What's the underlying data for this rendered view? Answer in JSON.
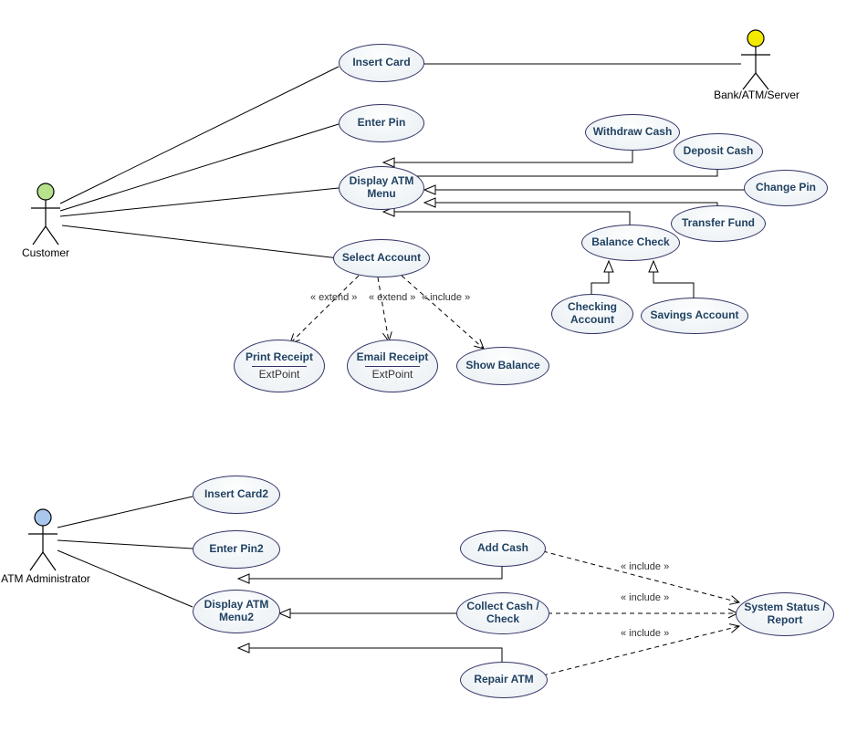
{
  "actors": {
    "customer": {
      "label": "Customer"
    },
    "bankServer": {
      "label": "Bank/ATM/Server"
    },
    "atmAdmin": {
      "label": "ATM Administrator"
    }
  },
  "usecases": {
    "insertCard": {
      "label": "Insert Card"
    },
    "enterPin": {
      "label": "Enter Pin"
    },
    "displayMenu": {
      "label": "Display ATM Menu"
    },
    "selectAccount": {
      "label": "Select Account"
    },
    "withdrawCash": {
      "label": "Withdraw Cash"
    },
    "depositCash": {
      "label": "Deposit Cash"
    },
    "changePin": {
      "label": "Change Pin"
    },
    "transferFund": {
      "label": "Transfer Fund"
    },
    "balanceCheck": {
      "label": "Balance Check"
    },
    "checkingAcct": {
      "label": "Checking Account"
    },
    "savingsAcct": {
      "label": "Savings Account"
    },
    "printReceipt": {
      "label": "Print Receipt",
      "extPoint": "ExtPoint"
    },
    "emailReceipt": {
      "label": "Email Receipt",
      "extPoint": "ExtPoint"
    },
    "showBalance": {
      "label": "Show Balance"
    },
    "insertCard2": {
      "label": "Insert Card2"
    },
    "enterPin2": {
      "label": "Enter Pin2"
    },
    "displayMenu2": {
      "label": "Display ATM Menu2"
    },
    "addCash": {
      "label": "Add Cash"
    },
    "collectCash": {
      "label": "Collect Cash / Check"
    },
    "repairATM": {
      "label": "Repair ATM"
    },
    "systemStatus": {
      "label": "System Status / Report"
    }
  },
  "relationLabels": {
    "extend1": "« extend »",
    "extend2": "« extend »",
    "include1": "« include »",
    "include2": "« include »",
    "include3": "« include »",
    "include4": "« include »"
  },
  "chart_data": {
    "type": "uml-usecase-diagram",
    "actors": [
      {
        "id": "customer",
        "name": "Customer"
      },
      {
        "id": "bankServer",
        "name": "Bank/ATM/Server"
      },
      {
        "id": "atmAdmin",
        "name": "ATM Administrator"
      }
    ],
    "usecases": [
      {
        "id": "insertCard",
        "name": "Insert Card"
      },
      {
        "id": "enterPin",
        "name": "Enter Pin"
      },
      {
        "id": "displayMenu",
        "name": "Display ATM Menu"
      },
      {
        "id": "selectAccount",
        "name": "Select Account"
      },
      {
        "id": "withdrawCash",
        "name": "Withdraw Cash"
      },
      {
        "id": "depositCash",
        "name": "Deposit Cash"
      },
      {
        "id": "changePin",
        "name": "Change Pin"
      },
      {
        "id": "transferFund",
        "name": "Transfer Fund"
      },
      {
        "id": "balanceCheck",
        "name": "Balance Check"
      },
      {
        "id": "checkingAcct",
        "name": "Checking Account"
      },
      {
        "id": "savingsAcct",
        "name": "Savings Account"
      },
      {
        "id": "printReceipt",
        "name": "Print Receipt",
        "extensionPoint": "ExtPoint"
      },
      {
        "id": "emailReceipt",
        "name": "Email Receipt",
        "extensionPoint": "ExtPoint"
      },
      {
        "id": "showBalance",
        "name": "Show Balance"
      },
      {
        "id": "insertCard2",
        "name": "Insert Card2"
      },
      {
        "id": "enterPin2",
        "name": "Enter Pin2"
      },
      {
        "id": "displayMenu2",
        "name": "Display ATM Menu2"
      },
      {
        "id": "addCash",
        "name": "Add Cash"
      },
      {
        "id": "collectCash",
        "name": "Collect Cash / Check"
      },
      {
        "id": "repairATM",
        "name": "Repair ATM"
      },
      {
        "id": "systemStatus",
        "name": "System Status / Report"
      }
    ],
    "associations": [
      {
        "from": "customer",
        "to": "insertCard"
      },
      {
        "from": "customer",
        "to": "enterPin"
      },
      {
        "from": "customer",
        "to": "displayMenu"
      },
      {
        "from": "customer",
        "to": "selectAccount"
      },
      {
        "from": "bankServer",
        "to": "insertCard"
      },
      {
        "from": "atmAdmin",
        "to": "insertCard2"
      },
      {
        "from": "atmAdmin",
        "to": "enterPin2"
      },
      {
        "from": "atmAdmin",
        "to": "displayMenu2"
      }
    ],
    "generalizations_childToParent": [
      {
        "child": "withdrawCash",
        "parent": "displayMenu"
      },
      {
        "child": "depositCash",
        "parent": "displayMenu"
      },
      {
        "child": "changePin",
        "parent": "displayMenu"
      },
      {
        "child": "transferFund",
        "parent": "displayMenu"
      },
      {
        "child": "balanceCheck",
        "parent": "displayMenu"
      },
      {
        "child": "checkingAcct",
        "parent": "balanceCheck"
      },
      {
        "child": "savingsAcct",
        "parent": "balanceCheck"
      },
      {
        "child": "addCash",
        "parent": "displayMenu2"
      },
      {
        "child": "collectCash",
        "parent": "displayMenu2"
      },
      {
        "child": "repairATM",
        "parent": "displayMenu2"
      }
    ],
    "dependencies": [
      {
        "from": "selectAccount",
        "to": "printReceipt",
        "stereotype": "extend"
      },
      {
        "from": "selectAccount",
        "to": "emailReceipt",
        "stereotype": "extend"
      },
      {
        "from": "selectAccount",
        "to": "showBalance",
        "stereotype": "include"
      },
      {
        "from": "addCash",
        "to": "systemStatus",
        "stereotype": "include"
      },
      {
        "from": "collectCash",
        "to": "systemStatus",
        "stereotype": "include"
      },
      {
        "from": "repairATM",
        "to": "systemStatus",
        "stereotype": "include"
      }
    ]
  }
}
